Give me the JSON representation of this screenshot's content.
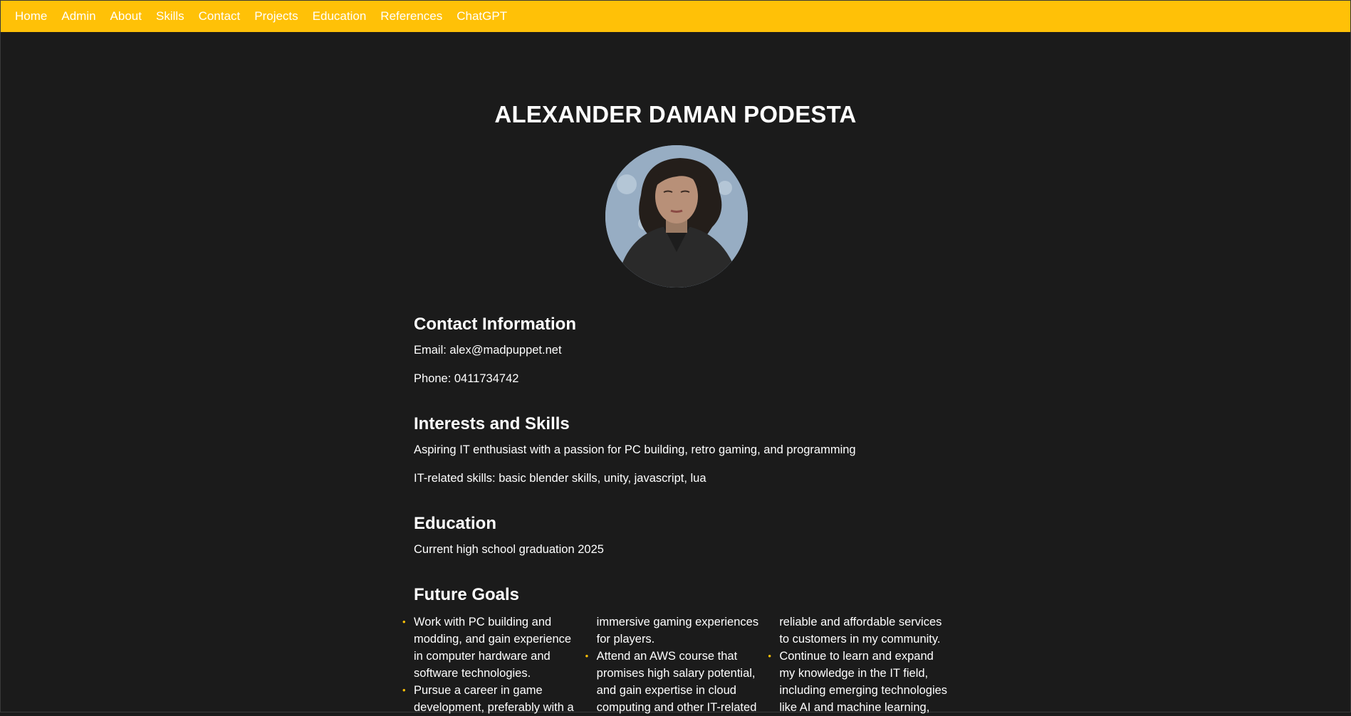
{
  "nav": {
    "items": [
      "Home",
      "Admin",
      "About",
      "Skills",
      "Contact",
      "Projects",
      "Education",
      "References",
      "ChatGPT"
    ]
  },
  "header": {
    "name": "ALEXANDER DAMAN PODESTA"
  },
  "contact": {
    "heading": "Contact Information",
    "email": "Email: alex@madpuppet.net",
    "phone": "Phone: 0411734742"
  },
  "skills": {
    "heading": "Interests and Skills",
    "summary": "Aspiring IT enthusiast with a passion for PC building, retro gaming, and programming",
    "it_skills": "IT-related skills: basic blender skills, unity, javascript, lua"
  },
  "education": {
    "heading": "Education",
    "detail": "Current high school graduation 2025"
  },
  "goals": {
    "heading": "Future Goals",
    "items": [
      "Work with PC building and modding, and gain experience in computer hardware and software technologies.",
      "Pursue a career in game development, preferably with a",
      "immersive gaming experiences for players.",
      "Attend an AWS course that promises high salary potential, and gain expertise in cloud computing and other IT-related",
      "reliable and affordable services to customers in my community.",
      "Continue to learn and expand my knowledge in the IT field, including emerging technologies like AI and machine learning,"
    ]
  },
  "colors": {
    "accent": "#ffc107",
    "background": "#1b1b1b",
    "text": "#ffffff"
  },
  "avatar": {
    "icon": "profile-avatar-illustration"
  }
}
